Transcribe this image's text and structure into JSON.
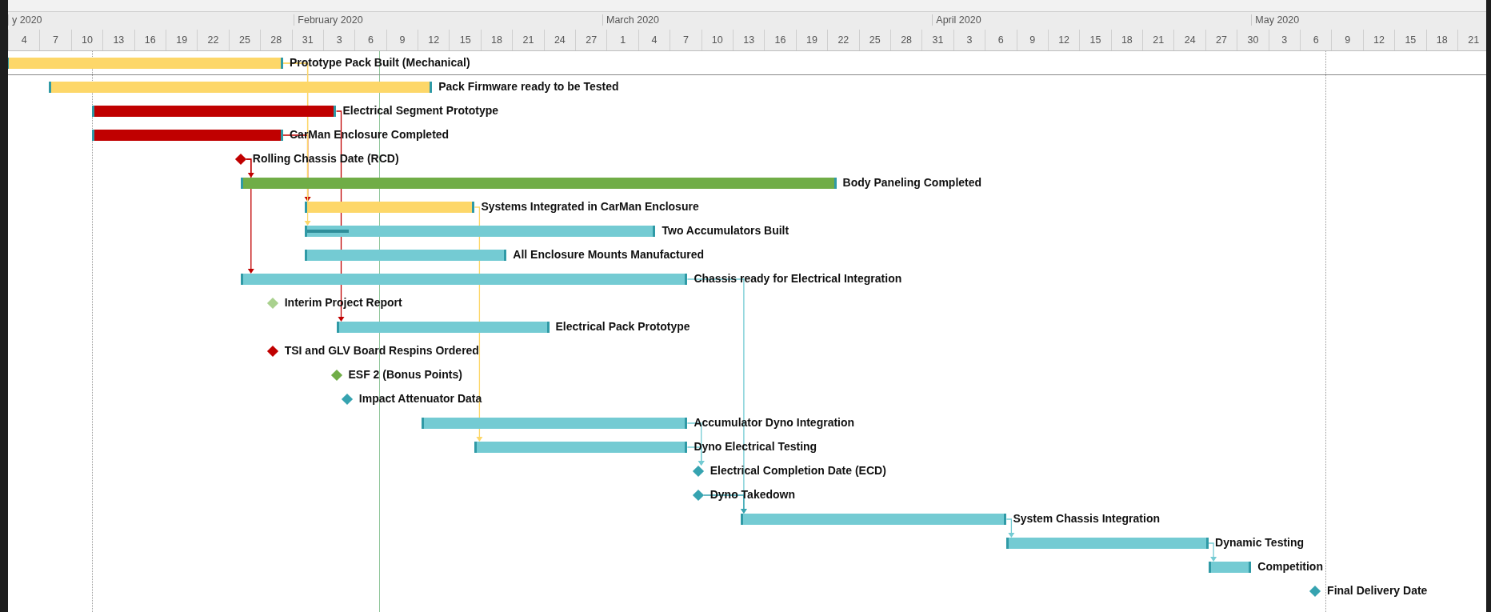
{
  "timescale": {
    "months": [
      "y 2020",
      "February 2020",
      "March 2020",
      "April 2020",
      "May 2020"
    ],
    "days": [
      "4",
      "7",
      "10",
      "13",
      "16",
      "19",
      "22",
      "25",
      "28",
      "31",
      "3",
      "6",
      "9",
      "12",
      "15",
      "18",
      "21",
      "24",
      "27",
      "1",
      "4",
      "7",
      "10",
      "13",
      "16",
      "19",
      "22",
      "25",
      "28",
      "31",
      "3",
      "6",
      "9",
      "12",
      "15",
      "18",
      "21",
      "24",
      "27",
      "30",
      "3",
      "6",
      "9",
      "12",
      "15",
      "18",
      "21"
    ]
  },
  "tasks": [
    {
      "kind": "bar",
      "label": "Prototype Pack Built (Mechanical)",
      "color": "#fdd769"
    },
    {
      "kind": "bar",
      "label": "Pack Firmware ready to be Tested",
      "color": "#fdd769"
    },
    {
      "kind": "bar",
      "label": "Electrical Segment Prototype",
      "color": "#c00000"
    },
    {
      "kind": "bar",
      "label": "CarMan Enclosure Completed",
      "color": "#c00000"
    },
    {
      "kind": "milestone",
      "label": "Rolling Chassis Date (RCD)",
      "color": "#c00000"
    },
    {
      "kind": "bar",
      "label": "Body Paneling Completed",
      "color": "#70ad47"
    },
    {
      "kind": "bar",
      "label": "Systems Integrated in CarMan Enclosure",
      "color": "#fdd769"
    },
    {
      "kind": "bar",
      "label": "Two Accumulators Built",
      "color": "#74cbd3",
      "level": 0.12
    },
    {
      "kind": "bar",
      "label": "All Enclosure Mounts Manufactured",
      "color": "#74cbd3"
    },
    {
      "kind": "bar",
      "label": "Chassis ready for Electrical Integration",
      "color": "#74cbd3"
    },
    {
      "kind": "milestone",
      "label": "Interim Project Report",
      "color": "#a9d18e"
    },
    {
      "kind": "bar",
      "label": "Electrical Pack Prototype",
      "color": "#74cbd3"
    },
    {
      "kind": "milestone",
      "label": "TSI and GLV Board Respins Ordered",
      "color": "#c00000"
    },
    {
      "kind": "milestone",
      "label": "ESF 2 (Bonus Points)",
      "color": "#70ad47"
    },
    {
      "kind": "milestone",
      "label": "Impact Attenuator Data",
      "color": "#36a3b0"
    },
    {
      "kind": "bar",
      "label": "Accumulator Dyno Integration",
      "color": "#74cbd3"
    },
    {
      "kind": "bar",
      "label": "Dyno Electrical Testing",
      "color": "#74cbd3"
    },
    {
      "kind": "milestone",
      "label": "Electrical Completion Date (ECD)",
      "color": "#36a3b0"
    },
    {
      "kind": "milestone",
      "label": "Dyno Takedown",
      "color": "#36a3b0"
    },
    {
      "kind": "bar",
      "label": "System Chassis Integration",
      "color": "#74cbd3"
    },
    {
      "kind": "bar",
      "label": "Dynamic Testing",
      "color": "#74cbd3"
    },
    {
      "kind": "bar",
      "label": "Competition",
      "color": "#74cbd3"
    },
    {
      "kind": "milestone",
      "label": "Final Delivery Date",
      "color": "#36a3b0"
    }
  ]
}
